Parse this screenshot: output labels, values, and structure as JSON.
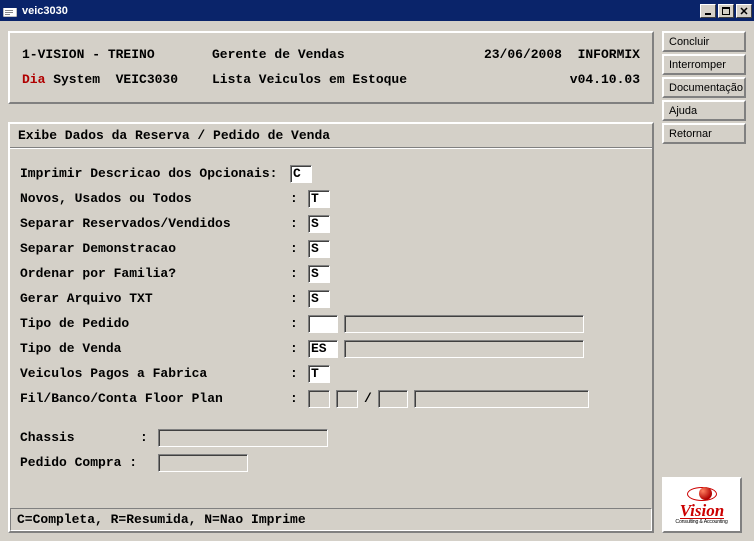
{
  "window": {
    "title": "veic3030"
  },
  "header": {
    "line1_left": "1-VISION - TREINO",
    "line1_mid": "Gerente de Vendas",
    "line1_date": "23/06/2008",
    "line1_db": "INFORMIX",
    "line2_dia": "Dia",
    "line2_left": " System  VEIC3030",
    "line2_mid": "Lista Veiculos em Estoque",
    "line2_ver": "v04.10.03"
  },
  "form": {
    "title": "Exibe Dados da Reserva / Pedido de Venda",
    "rows": {
      "r1": {
        "label": "Imprimir Descricao dos Opcionais",
        "val": "C"
      },
      "r2": {
        "label": "Novos, Usados ou Todos",
        "val": "T"
      },
      "r3": {
        "label": "Separar Reservados/Vendidos",
        "val": "S"
      },
      "r4": {
        "label": "Separar Demonstracao",
        "val": "S"
      },
      "r5": {
        "label": "Ordenar por Familia?",
        "val": "S"
      },
      "r6": {
        "label": "Gerar Arquivo TXT",
        "val": "S"
      },
      "r7": {
        "label": "Tipo de Pedido",
        "val": "",
        "desc": ""
      },
      "r8": {
        "label": "Tipo de Venda",
        "val": "ES",
        "desc": ""
      },
      "r9": {
        "label": "Veiculos Pagos a Fabrica",
        "val": "T"
      },
      "r10": {
        "label": "Fil/Banco/Conta Floor Plan",
        "f1": "",
        "f2": "",
        "f3": "",
        "desc": ""
      },
      "r11": {
        "label": "Chassis",
        "val": ""
      },
      "r12": {
        "label": "Pedido Compra",
        "val": ""
      }
    },
    "hint": "C=Completa, R=Resumida, N=Nao Imprime"
  },
  "buttons": {
    "b1": "Concluir",
    "b2": "Interromper",
    "b3": "Documentação",
    "b4": "Ajuda",
    "b5": "Retornar"
  },
  "logo": {
    "text": "Vision",
    "sub": "Consulting & Accounting"
  }
}
